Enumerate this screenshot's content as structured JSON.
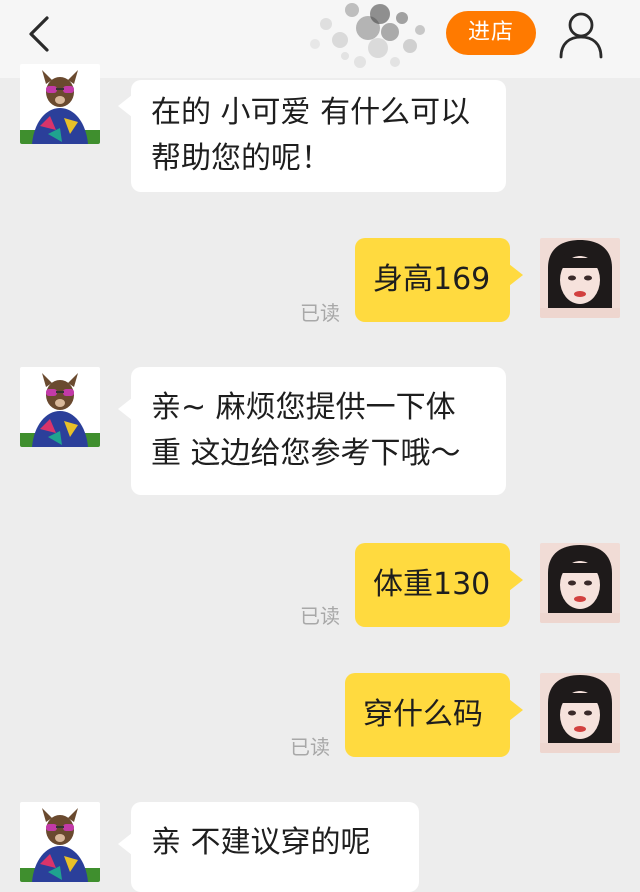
{
  "header": {
    "back_icon": "chevron-left-icon",
    "shop_button_label": "进店",
    "profile_icon": "user-icon",
    "colors": {
      "accent": "#ff7a00",
      "bar_bg": "#f6f6f6"
    }
  },
  "chat": {
    "colors": {
      "background": "#ededed",
      "sent_bubble": "#ffda3f",
      "received_bubble": "#ffffff",
      "read_text": "#a8a8a8"
    },
    "messages": [
      {
        "from": "shop",
        "lines": [
          "在的 小可爱 有什么可以",
          "帮助您的呢！"
        ]
      },
      {
        "from": "me",
        "text": "身高169",
        "status": "已读"
      },
      {
        "from": "shop",
        "lines": [
          "亲~  麻烦您提供一下体",
          "重  这边给您参考下哦～"
        ]
      },
      {
        "from": "me",
        "text": "体重130",
        "status": "已读"
      },
      {
        "from": "me",
        "text": "穿什么码",
        "status": "已读"
      },
      {
        "from": "shop",
        "lines": [
          "亲   不建议穿的呢"
        ]
      }
    ]
  }
}
